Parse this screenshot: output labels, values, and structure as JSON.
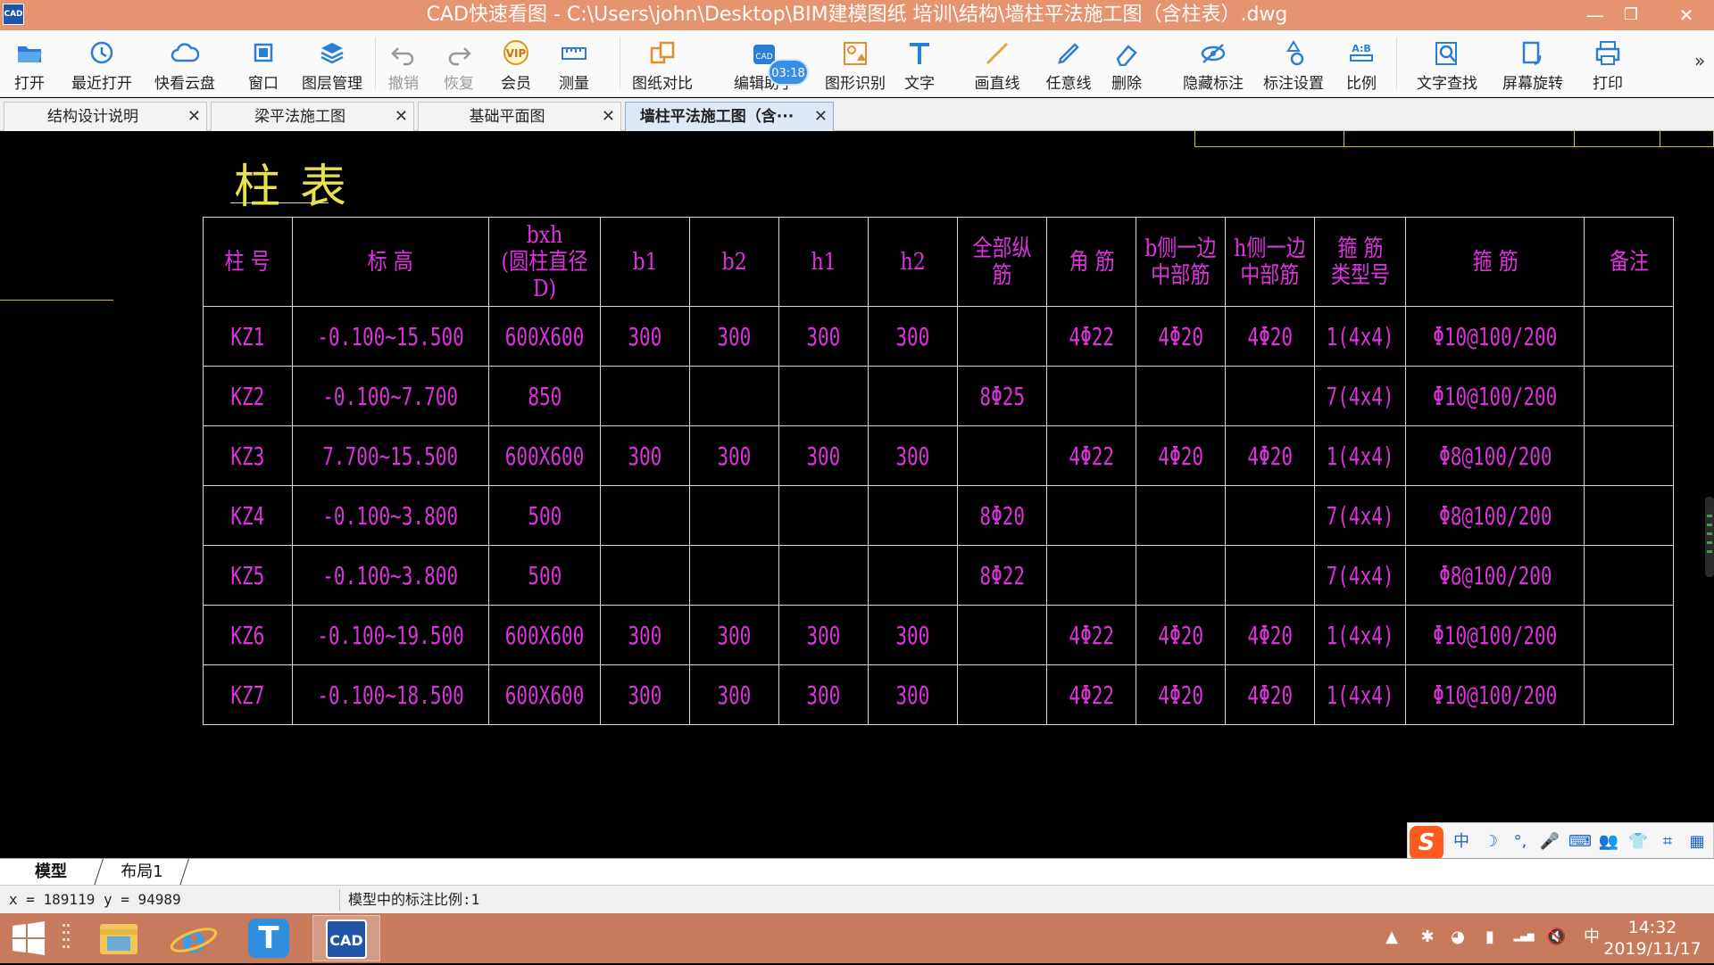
{
  "window": {
    "title": "CAD快速看图 - C:\\Users\\john\\Desktop\\BIM建模图纸  培训\\结构\\墙柱平法施工图（含柱表）.dwg",
    "app_icon_text": "CAD",
    "controls": {
      "minimize": "—",
      "maximize": "❐",
      "close": "✕"
    }
  },
  "toolbar": {
    "items": [
      {
        "label": "打开",
        "icon": "folder-open-icon"
      },
      {
        "label": "最近打开",
        "icon": "history-icon"
      },
      {
        "label": "快看云盘",
        "icon": "cloud-icon"
      },
      {
        "label": "窗口",
        "icon": "window-icon"
      },
      {
        "label": "图层管理",
        "icon": "layers-icon"
      },
      {
        "label": "撤销",
        "icon": "undo-icon"
      },
      {
        "label": "恢复",
        "icon": "redo-icon"
      },
      {
        "label": "会员",
        "icon": "vip-icon",
        "icon_text": "VIP"
      },
      {
        "label": "测量",
        "icon": "ruler-icon"
      },
      {
        "label": "图纸对比",
        "icon": "compare-icon"
      },
      {
        "label": "编辑助手",
        "icon": "edit-assistant-icon"
      },
      {
        "label": "图形识别",
        "icon": "shape-recognition-icon"
      },
      {
        "label": "文字",
        "icon": "text-icon"
      },
      {
        "label": "画直线",
        "icon": "line-icon"
      },
      {
        "label": "任意线",
        "icon": "freehand-icon"
      },
      {
        "label": "删除",
        "icon": "eraser-icon"
      },
      {
        "label": "隐藏标注",
        "icon": "hide-annotation-icon"
      },
      {
        "label": "标注设置",
        "icon": "annotation-settings-icon"
      },
      {
        "label": "比例",
        "icon": "scale-icon",
        "icon_text": "A:B"
      },
      {
        "label": "文字查找",
        "icon": "text-search-icon"
      },
      {
        "label": "屏幕旋转",
        "icon": "rotate-screen-icon"
      },
      {
        "label": "打印",
        "icon": "print-icon"
      }
    ],
    "timer_badge": "03:18",
    "overflow": "»"
  },
  "tabs": [
    {
      "label": "结构设计说明",
      "close": "✕"
    },
    {
      "label": "梁平法施工图",
      "close": "✕"
    },
    {
      "label": "基础平面图",
      "close": "✕"
    },
    {
      "label": "墙柱平法施工图（含···",
      "close": "✕"
    }
  ],
  "drawing": {
    "title": "柱表",
    "headers": [
      "柱 号",
      "标 高",
      "bxh\n(圆柱直径D)",
      "b1",
      "b2",
      "h1",
      "h2",
      "全部纵筋",
      "角 筋",
      "b侧一边\n中部筋",
      "h侧一边\n中部筋",
      "箍 筋\n类型号",
      "箍 筋",
      "备注"
    ],
    "rows": [
      [
        "KZ1",
        "-0.100~15.500",
        "600X600",
        "300",
        "300",
        "300",
        "300",
        "",
        "4Φ22",
        "4Φ20",
        "4Φ20",
        "1(4x4)",
        "Φ10@100/200",
        ""
      ],
      [
        "KZ2",
        "-0.100~7.700",
        "850",
        "",
        "",
        "",
        "",
        "8Φ25",
        "",
        "",
        "",
        "7(4x4)",
        "Φ10@100/200",
        ""
      ],
      [
        "KZ3",
        "7.700~15.500",
        "600X600",
        "300",
        "300",
        "300",
        "300",
        "",
        "4Φ22",
        "4Φ20",
        "4Φ20",
        "1(4x4)",
        "Φ8@100/200",
        ""
      ],
      [
        "KZ4",
        "-0.100~3.800",
        "500",
        "",
        "",
        "",
        "",
        "8Φ20",
        "",
        "",
        "",
        "7(4x4)",
        "Φ8@100/200",
        ""
      ],
      [
        "KZ5",
        "-0.100~3.800",
        "500",
        "",
        "",
        "",
        "",
        "8Φ22",
        "",
        "",
        "",
        "7(4x4)",
        "Φ8@100/200",
        ""
      ],
      [
        "KZ6",
        "-0.100~19.500",
        "600X600",
        "300",
        "300",
        "300",
        "300",
        "",
        "4Φ22",
        "4Φ20",
        "4Φ20",
        "1(4x4)",
        "Φ10@100/200",
        ""
      ],
      [
        "KZ7",
        "-0.100~18.500",
        "600X600",
        "300",
        "300",
        "300",
        "300",
        "",
        "4Φ22",
        "4Φ20",
        "4Φ20",
        "1(4x4)",
        "Φ10@100/200",
        ""
      ]
    ],
    "colors": {
      "title": "#e7e14a",
      "text": "#dd33dd",
      "lines": "#d8d8d8"
    }
  },
  "ime": {
    "logo": "S",
    "icons": [
      {
        "name": "chinese-mode-icon",
        "glyph": "中"
      },
      {
        "name": "moon-icon",
        "glyph": "☽"
      },
      {
        "name": "punctuation-icon",
        "glyph": "°,"
      },
      {
        "name": "microphone-icon",
        "glyph": "🎤"
      },
      {
        "name": "keyboard-icon",
        "glyph": "⌨"
      },
      {
        "name": "user-icon",
        "glyph": "👥"
      },
      {
        "name": "skin-icon",
        "glyph": "👕"
      },
      {
        "name": "crop-icon",
        "glyph": "⌗"
      },
      {
        "name": "grid-icon",
        "glyph": "▦"
      }
    ]
  },
  "layout_tabs": [
    "模型",
    "布局1"
  ],
  "status": {
    "coords": "x = 189119  y = 94989",
    "scale_text": "模型中的标注比例:1"
  },
  "taskbar": {
    "clock_time": "14:32",
    "clock_date": "2019/11/17",
    "apps": [
      {
        "name": "file-explorer-icon"
      },
      {
        "name": "internet-explorer-icon"
      },
      {
        "name": "text-app-icon",
        "glyph": "T"
      },
      {
        "name": "cad-app-icon",
        "glyph": "CAD"
      }
    ],
    "tray": [
      {
        "name": "tray-expand-icon",
        "glyph": "▲"
      },
      {
        "name": "tray-bluetooth-icon",
        "glyph": "✱"
      },
      {
        "name": "tray-wechat-icon",
        "glyph": "◕"
      },
      {
        "name": "tray-battery-icon",
        "glyph": "▮"
      },
      {
        "name": "tray-network-icon",
        "glyph": "▂▄▆"
      },
      {
        "name": "tray-volume-muted-icon",
        "glyph": "🔇"
      },
      {
        "name": "tray-ime-icon",
        "glyph": "中"
      }
    ]
  }
}
